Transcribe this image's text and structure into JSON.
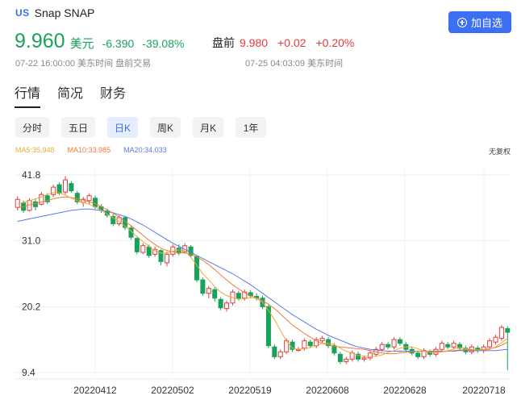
{
  "header": {
    "market": "US",
    "name": "Snap SNAP",
    "add_label": "加自选"
  },
  "quote": {
    "price": "9.960",
    "unit": "美元",
    "change": "-6.390",
    "change_pct": "-39.08%",
    "premarket_label": "盘前",
    "premarket_price": "9.980",
    "premarket_change": "+0.02",
    "premarket_pct": "+0.20%",
    "close_time": "07-22 16:00:00 美东时间 盘前交易",
    "pre_time": "07-25 04:03:09 美东时间"
  },
  "main_tabs": [
    "行情",
    "简况",
    "财务"
  ],
  "period_tabs": [
    "分时",
    "五日",
    "日K",
    "周K",
    "月K",
    "1年"
  ],
  "active_period": "日K",
  "ma": {
    "ma5": "MA5:35.948",
    "ma10": "MA10:33.985",
    "ma20": "MA20:34.033",
    "fq": "无复权"
  },
  "colors": {
    "up": "#e23b3b",
    "down": "#17a35a",
    "ma5": "#f0a93a",
    "ma10": "#f07a3a",
    "ma20": "#5a79e6",
    "accent": "#3d6ff2"
  },
  "chart_data": {
    "type": "candlestick",
    "y_ticks": [
      "41.8",
      "31.0",
      "20.2",
      "9.4"
    ],
    "ylim": [
      9.4,
      41.8
    ],
    "x_ticks": [
      "20220412",
      "20220502",
      "20220519",
      "20220608",
      "20220628",
      "20220718"
    ],
    "grid": true,
    "candles": [
      [
        36.5,
        37.8,
        36.0,
        38.3
      ],
      [
        37.2,
        36.0,
        35.6,
        37.6
      ],
      [
        36.0,
        37.6,
        35.8,
        38.0
      ],
      [
        37.4,
        36.6,
        36.0,
        37.9
      ],
      [
        37.0,
        38.6,
        36.8,
        39.0
      ],
      [
        38.4,
        37.4,
        37.0,
        38.8
      ],
      [
        38.6,
        39.8,
        38.2,
        40.2
      ],
      [
        40.2,
        38.8,
        38.5,
        40.6
      ],
      [
        39.0,
        41.0,
        38.6,
        41.6
      ],
      [
        40.4,
        39.2,
        38.9,
        40.8
      ],
      [
        38.8,
        37.4,
        37.0,
        39.2
      ],
      [
        37.3,
        37.8,
        36.6,
        38.2
      ],
      [
        37.6,
        38.4,
        37.0,
        38.8
      ],
      [
        38.0,
        36.6,
        36.2,
        38.4
      ],
      [
        36.6,
        36.0,
        35.6,
        37.0
      ],
      [
        35.9,
        35.2,
        34.8,
        36.3
      ],
      [
        35.0,
        33.8,
        33.4,
        35.4
      ],
      [
        33.8,
        34.8,
        33.4,
        35.2
      ],
      [
        34.8,
        33.2,
        32.8,
        35.0
      ],
      [
        33.1,
        31.6,
        31.2,
        33.4
      ],
      [
        31.4,
        29.2,
        28.8,
        31.8
      ],
      [
        29.1,
        30.2,
        28.8,
        30.6
      ],
      [
        30.0,
        28.6,
        28.2,
        30.4
      ],
      [
        28.8,
        29.6,
        28.4,
        30.1
      ],
      [
        29.4,
        27.6,
        27.0,
        29.6
      ],
      [
        27.4,
        28.8,
        26.8,
        29.2
      ],
      [
        28.8,
        30.0,
        28.4,
        30.4
      ],
      [
        29.8,
        29.0,
        28.6,
        30.4
      ],
      [
        29.2,
        30.2,
        28.9,
        30.6
      ],
      [
        30.0,
        28.6,
        28.3,
        30.3
      ],
      [
        28.4,
        24.6,
        24.2,
        28.6
      ],
      [
        24.6,
        22.4,
        22.0,
        25.0
      ],
      [
        22.4,
        23.2,
        21.6,
        23.6
      ],
      [
        23.0,
        21.6,
        21.0,
        23.4
      ],
      [
        21.4,
        20.0,
        19.6,
        21.8
      ],
      [
        19.9,
        20.8,
        19.4,
        21.2
      ],
      [
        20.8,
        22.6,
        20.4,
        23.0
      ],
      [
        22.4,
        21.6,
        21.2,
        22.8
      ],
      [
        21.6,
        22.6,
        21.2,
        23.0
      ],
      [
        22.5,
        22.0,
        21.6,
        22.9
      ],
      [
        21.9,
        21.6,
        21.2,
        22.4
      ],
      [
        21.6,
        20.2,
        19.8,
        22.0
      ],
      [
        20.2,
        13.8,
        13.4,
        20.6
      ],
      [
        13.6,
        12.0,
        11.6,
        14.0
      ],
      [
        12.0,
        12.8,
        11.6,
        13.2
      ],
      [
        12.8,
        14.6,
        12.4,
        15.0
      ],
      [
        14.4,
        13.2,
        12.8,
        14.8
      ],
      [
        13.2,
        13.2,
        12.8,
        13.6
      ],
      [
        13.4,
        14.6,
        13.0,
        15.0
      ],
      [
        14.4,
        13.8,
        13.4,
        14.8
      ],
      [
        13.8,
        14.8,
        13.4,
        15.2
      ],
      [
        14.6,
        15.0,
        14.2,
        15.4
      ],
      [
        14.8,
        13.8,
        13.4,
        15.2
      ],
      [
        13.8,
        12.6,
        12.2,
        14.2
      ],
      [
        12.4,
        11.2,
        10.8,
        12.8
      ],
      [
        11.2,
        11.6,
        10.8,
        12.0
      ],
      [
        11.6,
        12.6,
        11.2,
        13.0
      ],
      [
        12.4,
        11.6,
        11.2,
        12.8
      ],
      [
        11.6,
        11.8,
        11.2,
        12.2
      ],
      [
        11.8,
        12.6,
        11.4,
        13.0
      ],
      [
        12.4,
        13.2,
        12.0,
        13.6
      ],
      [
        13.2,
        14.0,
        12.8,
        14.4
      ],
      [
        14.0,
        13.6,
        13.2,
        14.4
      ],
      [
        13.6,
        14.8,
        13.2,
        15.2
      ],
      [
        14.8,
        14.2,
        13.8,
        15.2
      ],
      [
        14.0,
        13.2,
        12.8,
        14.4
      ],
      [
        13.2,
        12.6,
        12.2,
        13.6
      ],
      [
        12.6,
        12.0,
        11.6,
        13.0
      ],
      [
        12.0,
        13.0,
        11.6,
        13.4
      ],
      [
        12.8,
        12.4,
        12.0,
        13.2
      ],
      [
        12.4,
        13.2,
        12.0,
        13.6
      ],
      [
        13.2,
        14.2,
        12.8,
        14.6
      ],
      [
        14.0,
        13.6,
        13.2,
        14.4
      ],
      [
        13.6,
        14.2,
        13.2,
        14.6
      ],
      [
        14.0,
        13.4,
        13.0,
        14.4
      ],
      [
        13.4,
        12.8,
        12.4,
        13.8
      ],
      [
        12.8,
        13.6,
        12.4,
        14.0
      ],
      [
        13.4,
        13.0,
        12.6,
        13.8
      ],
      [
        13.0,
        13.6,
        12.6,
        14.0
      ],
      [
        13.6,
        14.6,
        13.2,
        15.0
      ],
      [
        14.4,
        15.2,
        14.0,
        15.6
      ],
      [
        15.0,
        16.8,
        14.6,
        17.2
      ],
      [
        16.6,
        16.0,
        9.8,
        17.0
      ]
    ],
    "ma5": [
      37.0,
      37.3,
      37.6,
      37.9,
      38.2,
      38.6,
      38.9,
      38.9,
      38.5,
      38.0,
      37.6,
      37.3,
      37.0,
      36.6,
      36.0,
      35.4,
      34.8,
      34.1,
      33.4,
      32.6,
      31.7,
      30.9,
      30.1,
      29.4,
      29.0,
      29.0,
      29.3,
      29.5,
      29.4,
      28.3,
      27.0,
      25.6,
      24.6,
      23.5,
      22.6,
      22.0,
      21.7,
      21.4,
      21.5,
      21.7,
      21.6,
      20.9,
      19.6,
      18.1,
      16.3,
      14.6,
      13.4,
      13.2,
      13.3,
      13.5,
      13.8,
      14.2,
      14.2,
      14.0,
      13.4,
      12.9,
      12.6,
      12.2,
      12.1,
      12.0,
      12.1,
      12.3,
      12.7,
      13.0,
      13.4,
      13.6,
      13.6,
      13.3,
      12.9,
      12.7,
      12.6,
      12.8,
      13.0,
      13.3,
      13.5,
      13.3,
      13.2,
      13.1,
      13.1,
      13.2,
      13.6,
      14.3,
      15.0
    ],
    "ma10": [
      36.4,
      36.6,
      36.9,
      37.1,
      37.4,
      37.6,
      37.9,
      38.1,
      38.2,
      38.1,
      37.9,
      37.7,
      37.4,
      37.1,
      36.6,
      36.1,
      35.5,
      34.9,
      34.2,
      33.5,
      32.7,
      31.9,
      31.1,
      30.4,
      29.8,
      29.4,
      29.2,
      29.1,
      29.0,
      28.8,
      28.4,
      27.8,
      27.1,
      26.3,
      25.4,
      24.6,
      23.8,
      23.1,
      22.5,
      22.0,
      21.6,
      21.2,
      20.6,
      19.9,
      19.0,
      18.1,
      17.2,
      16.5,
      15.8,
      15.2,
      14.6,
      14.2,
      13.9,
      13.7,
      13.6,
      13.5,
      13.4,
      13.3,
      13.2,
      13.0,
      12.8,
      12.6,
      12.5,
      12.5,
      12.6,
      12.7,
      12.8,
      12.9,
      12.9,
      12.9,
      12.8,
      12.8,
      12.9,
      13.0,
      13.1,
      13.1,
      13.1,
      13.1,
      13.2,
      13.3,
      13.5,
      13.9,
      14.4
    ],
    "ma20": [
      34.2,
      34.4,
      34.6,
      34.8,
      35.0,
      35.2,
      35.4,
      35.6,
      35.8,
      36.0,
      36.1,
      36.2,
      36.2,
      36.1,
      36.0,
      35.8,
      35.6,
      35.3,
      35.0,
      34.6,
      34.1,
      33.6,
      33.0,
      32.4,
      31.8,
      31.2,
      30.6,
      30.1,
      29.6,
      29.1,
      28.6,
      28.1,
      27.6,
      27.1,
      26.6,
      26.1,
      25.6,
      25.0,
      24.4,
      23.8,
      23.1,
      22.4,
      21.7,
      21.0,
      20.3,
      19.6,
      18.9,
      18.3,
      17.7,
      17.1,
      16.5,
      16.0,
      15.5,
      15.1,
      14.7,
      14.3,
      13.9,
      13.6,
      13.4,
      13.2,
      13.1,
      13.0,
      12.9,
      12.9,
      12.9,
      12.9,
      12.9,
      12.9,
      12.9,
      12.9,
      12.9,
      12.9,
      12.9,
      12.9,
      13.0,
      13.0,
      13.0,
      13.0,
      13.0,
      13.0,
      13.0,
      13.1,
      13.2
    ]
  }
}
